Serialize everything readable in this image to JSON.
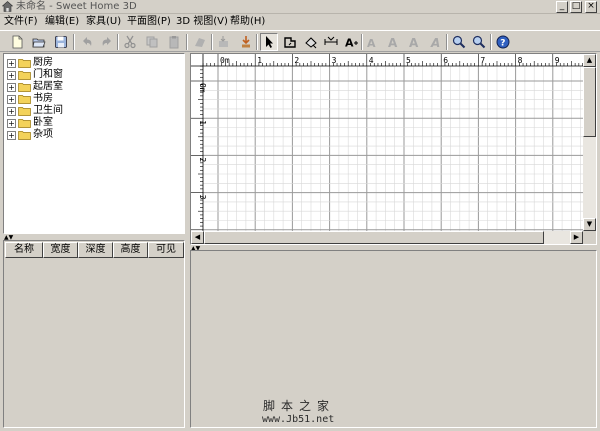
{
  "window": {
    "title": "未命名 - Sweet Home 3D",
    "minimize": "_",
    "maximize": "□",
    "close": "×"
  },
  "menu": [
    "文件(F)",
    "编辑(E)",
    "家具(U)",
    "平面图(P)",
    "3D 视图(V)",
    "帮助(H)"
  ],
  "toolbar": {
    "icons": [
      "new-file-icon",
      "open-folder-icon",
      "save-icon",
      "undo-icon",
      "redo-icon",
      "cut-icon",
      "copy-icon",
      "paste-icon",
      "add-furniture-icon",
      "import-furniture-icon",
      "import-model-icon",
      "select-arrow-icon",
      "create-walls-icon",
      "create-rooms-icon",
      "create-dimensions-icon",
      "add-text-icon",
      "text-style-icon",
      "increase-text-icon",
      "decrease-text-icon",
      "italic-text-icon",
      "zoom-in-icon",
      "zoom-out-icon",
      "help-icon"
    ]
  },
  "catalog": {
    "categories": [
      "厨房",
      "门和窗",
      "起居室",
      "书房",
      "卫生间",
      "卧室",
      "杂项"
    ]
  },
  "furniture_table": {
    "columns": [
      "名称",
      "宽度",
      "深度",
      "高度",
      "可见"
    ]
  },
  "plan": {
    "ruler_x": [
      "0m",
      "1",
      "2",
      "3",
      "4",
      "5",
      "6",
      "7",
      "8",
      "9"
    ],
    "ruler_y": [
      "0m",
      "1",
      "2",
      "3"
    ]
  },
  "watermark": {
    "site_name": "脚本之家",
    "url": "www.Jb51.net"
  }
}
